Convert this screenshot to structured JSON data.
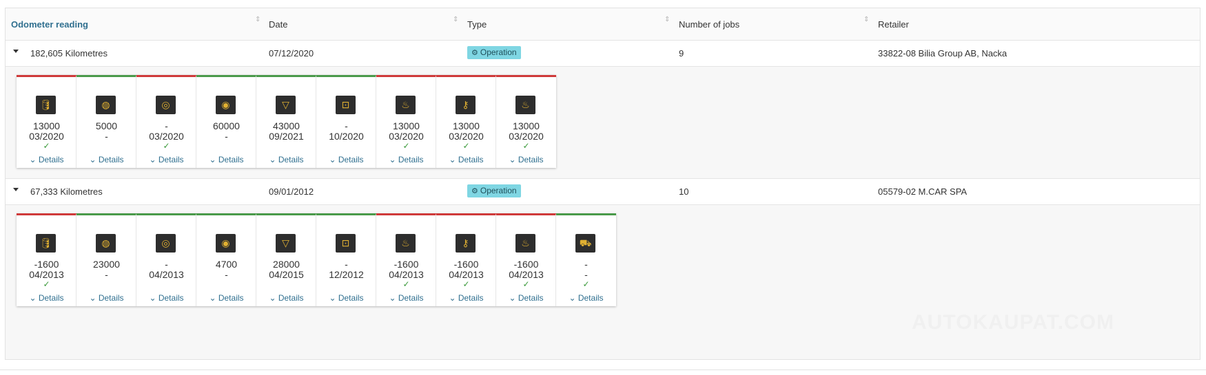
{
  "headers": {
    "odometer": "Odometer reading",
    "date": "Date",
    "type": "Type",
    "jobs": "Number of jobs",
    "retailer": "Retailer"
  },
  "sort_glyph": "⇕",
  "check_glyph": "✓",
  "details_label": "⌄ Details",
  "rows": [
    {
      "odometer": "182,605 Kilometres",
      "date": "07/12/2020",
      "type": "Operation",
      "type_icon": "gear-icon",
      "jobs": "9",
      "retailer": "33822-08 Bilia Group AB, Nacka",
      "tiles": [
        {
          "status": "red",
          "icon": "oil-can-icon",
          "glyph": "🛢",
          "v1": "13000",
          "v2": "03/2020",
          "check": true
        },
        {
          "status": "green",
          "icon": "brake-icon",
          "glyph": "◍",
          "v1": "5000",
          "v2": "-",
          "check": false
        },
        {
          "status": "red",
          "icon": "brake-disc-icon",
          "glyph": "◎",
          "v1": "-",
          "v2": "03/2020",
          "check": true
        },
        {
          "status": "green",
          "icon": "brake-pad-icon",
          "glyph": "◉",
          "v1": "60000",
          "v2": "-",
          "check": false
        },
        {
          "status": "green",
          "icon": "air-filter-icon",
          "glyph": "▽",
          "v1": "43000",
          "v2": "09/2021",
          "check": false
        },
        {
          "status": "green",
          "icon": "car-service-icon",
          "glyph": "⊡",
          "v1": "-",
          "v2": "10/2020",
          "check": false
        },
        {
          "status": "red",
          "icon": "fuel-filter-icon",
          "glyph": "♨",
          "v1": "13000",
          "v2": "03/2020",
          "check": true
        },
        {
          "status": "red",
          "icon": "spark-plug-icon",
          "glyph": "⚷",
          "v1": "13000",
          "v2": "03/2020",
          "check": true
        },
        {
          "status": "red",
          "icon": "engine-oil-icon",
          "glyph": "♨",
          "v1": "13000",
          "v2": "03/2020",
          "check": true
        }
      ]
    },
    {
      "odometer": "67,333 Kilometres",
      "date": "09/01/2012",
      "type": "Operation",
      "type_icon": "gear-icon",
      "jobs": "10",
      "retailer": "05579-02 M.CAR SPA",
      "tiles": [
        {
          "status": "red",
          "icon": "oil-can-icon",
          "glyph": "🛢",
          "v1": "-1600",
          "v2": "04/2013",
          "check": true
        },
        {
          "status": "green",
          "icon": "brake-icon",
          "glyph": "◍",
          "v1": "23000",
          "v2": "-",
          "check": false
        },
        {
          "status": "green",
          "icon": "brake-disc-icon",
          "glyph": "◎",
          "v1": "-",
          "v2": "04/2013",
          "check": false
        },
        {
          "status": "green",
          "icon": "brake-pad-icon",
          "glyph": "◉",
          "v1": "4700",
          "v2": "-",
          "check": false
        },
        {
          "status": "green",
          "icon": "air-filter-icon",
          "glyph": "▽",
          "v1": "28000",
          "v2": "04/2015",
          "check": false
        },
        {
          "status": "green",
          "icon": "car-service-icon",
          "glyph": "⊡",
          "v1": "-",
          "v2": "12/2012",
          "check": false
        },
        {
          "status": "red",
          "icon": "fuel-filter-icon",
          "glyph": "♨",
          "v1": "-1600",
          "v2": "04/2013",
          "check": true
        },
        {
          "status": "red",
          "icon": "spark-plug-icon",
          "glyph": "⚷",
          "v1": "-1600",
          "v2": "04/2013",
          "check": true
        },
        {
          "status": "red",
          "icon": "engine-oil-icon",
          "glyph": "♨",
          "v1": "-1600",
          "v2": "04/2013",
          "check": true
        },
        {
          "status": "green",
          "icon": "car-icon",
          "glyph": "⛟",
          "v1": "-",
          "v2": "-",
          "check": true
        }
      ]
    }
  ],
  "watermark": "AUTOKAUPAT.COM"
}
